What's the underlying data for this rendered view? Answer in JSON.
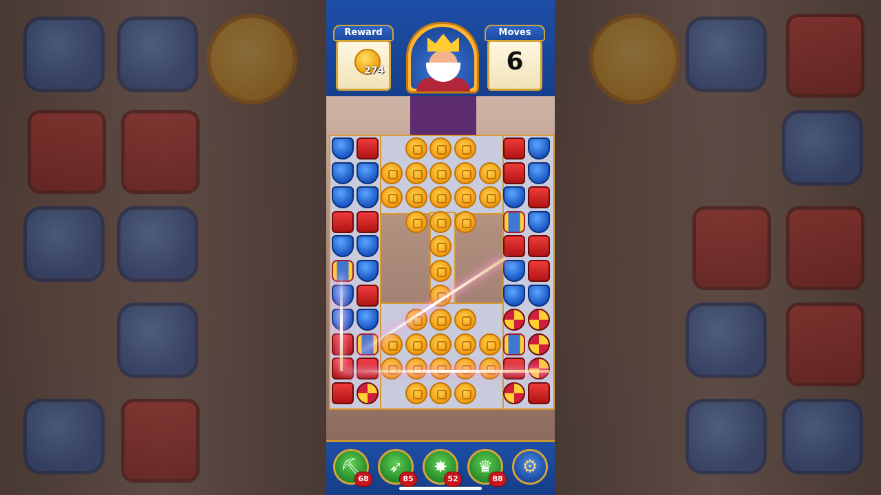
{
  "hud": {
    "reward_label": "Reward",
    "reward_value": "274",
    "moves_label": "Moves",
    "moves_value": "6"
  },
  "boosters": [
    {
      "name": "hammer-booster",
      "glyph": "⛏",
      "count": "68"
    },
    {
      "name": "arrow-booster",
      "glyph": "➶",
      "count": "85"
    },
    {
      "name": "cannon-booster",
      "glyph": "✸",
      "count": "52"
    },
    {
      "name": "jester-hat-booster",
      "glyph": "♛",
      "count": "88"
    }
  ],
  "settings": {
    "icon": "gear-icon",
    "glyph": "⚙"
  },
  "colors": {
    "hud_blue": "#1d4ea6",
    "gold_trim": "#d6a53a",
    "coin": "#f09b10",
    "box_red": "#d01f1f",
    "shield_blue": "#1b57c4",
    "badge_red": "#c8161d"
  }
}
